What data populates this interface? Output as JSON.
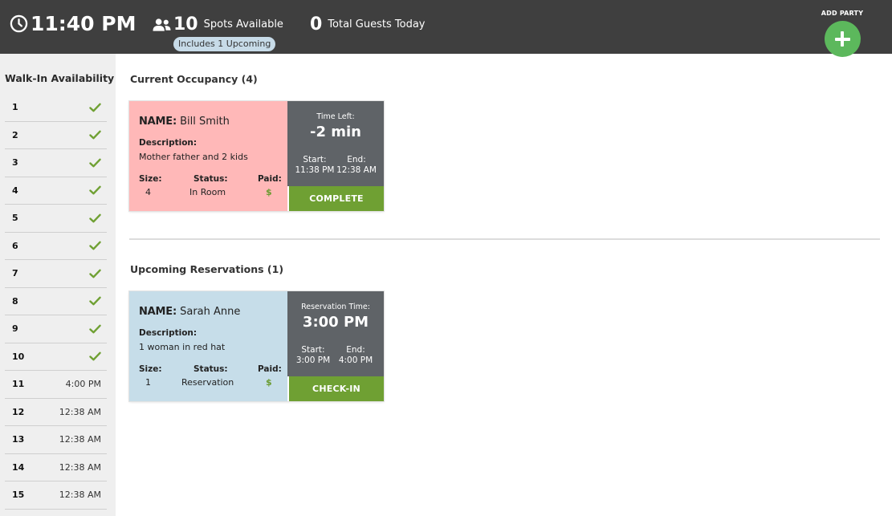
{
  "header": {
    "time": "11:40 PM",
    "spots_count": "10",
    "spots_label": "Spots Available",
    "upcoming_pill": "Includes 1 Upcoming",
    "guests_count": "0",
    "guests_label": "Total Guests Today",
    "add_party_label": "ADD PARTY"
  },
  "sidebar": {
    "title": "Walk-In Availability",
    "slots": [
      {
        "number": "1",
        "status": "available"
      },
      {
        "number": "2",
        "status": "available"
      },
      {
        "number": "3",
        "status": "available"
      },
      {
        "number": "4",
        "status": "available"
      },
      {
        "number": "5",
        "status": "available"
      },
      {
        "number": "6",
        "status": "available"
      },
      {
        "number": "7",
        "status": "available"
      },
      {
        "number": "8",
        "status": "available"
      },
      {
        "number": "9",
        "status": "available"
      },
      {
        "number": "10",
        "status": "available"
      },
      {
        "number": "11",
        "time": "4:00 PM"
      },
      {
        "number": "12",
        "time": "12:38 AM"
      },
      {
        "number": "13",
        "time": "12:38 AM"
      },
      {
        "number": "14",
        "time": "12:38 AM"
      },
      {
        "number": "15",
        "time": "12:38 AM"
      }
    ]
  },
  "occupancy": {
    "title": "Current Occupancy (4)",
    "card": {
      "name_label": "NAME:",
      "name": "Bill Smith",
      "description_label": "Description:",
      "description": "Mother father and 2 kids",
      "size_label": "Size:",
      "size": "4",
      "status_label": "Status:",
      "status": "In Room",
      "paid_label": "Paid:",
      "paid": "$",
      "time_caption": "Time Left:",
      "time_value": "-2 min",
      "start_label": "Start:",
      "start": "11:38 PM",
      "end_label": "End:",
      "end": "12:38 AM",
      "action": "COMPLETE"
    }
  },
  "upcoming": {
    "title": "Upcoming Reservations (1)",
    "card": {
      "name_label": "NAME:",
      "name": "Sarah Anne",
      "description_label": "Description:",
      "description": "1 woman in red hat",
      "size_label": "Size:",
      "size": "1",
      "status_label": "Status:",
      "status": "Reservation",
      "paid_label": "Paid:",
      "paid": "$",
      "time_caption": "Reservation Time:",
      "time_value": "3:00 PM",
      "start_label": "Start:",
      "start": "3:00 PM",
      "end_label": "End:",
      "end": "4:00 PM",
      "action": "CHECK-IN"
    }
  },
  "colors": {
    "header_bg": "#3f3f3f",
    "add_button": "#5cb85c",
    "check": "#6fa033",
    "occupied_card": "#ffb8b8",
    "reservation_card": "#c6dde9",
    "card_side": "#5f6367",
    "action_button": "#6fa033"
  },
  "icons": {
    "clock": "clock-icon",
    "people": "people-icon",
    "add": "plus-icon",
    "check": "check-icon"
  }
}
